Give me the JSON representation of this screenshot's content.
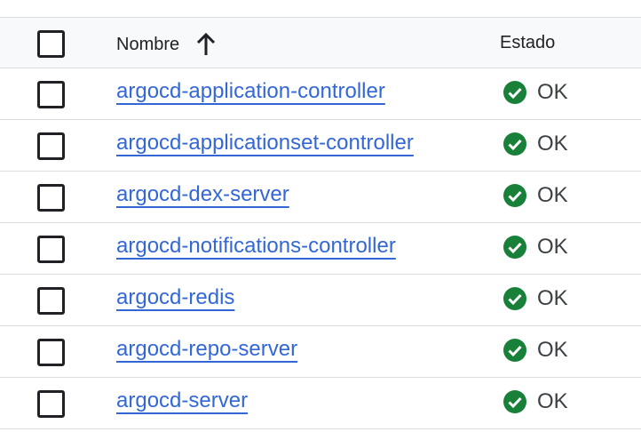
{
  "header": {
    "name_label": "Nombre",
    "status_label": "Estado",
    "sort_icon": "arrow-up-icon"
  },
  "colors": {
    "link": "#3367d6",
    "ok_green": "#188038",
    "border": "#dadce0",
    "header_bg": "#f8f9fa"
  },
  "rows": [
    {
      "name": "argocd-application-controller",
      "status": "OK",
      "status_icon": "check-circle-icon"
    },
    {
      "name": "argocd-applicationset-controller",
      "status": "OK",
      "status_icon": "check-circle-icon"
    },
    {
      "name": "argocd-dex-server",
      "status": "OK",
      "status_icon": "check-circle-icon"
    },
    {
      "name": "argocd-notifications-controller",
      "status": "OK",
      "status_icon": "check-circle-icon"
    },
    {
      "name": "argocd-redis",
      "status": "OK",
      "status_icon": "check-circle-icon"
    },
    {
      "name": "argocd-repo-server",
      "status": "OK",
      "status_icon": "check-circle-icon"
    },
    {
      "name": "argocd-server",
      "status": "OK",
      "status_icon": "check-circle-icon"
    }
  ]
}
